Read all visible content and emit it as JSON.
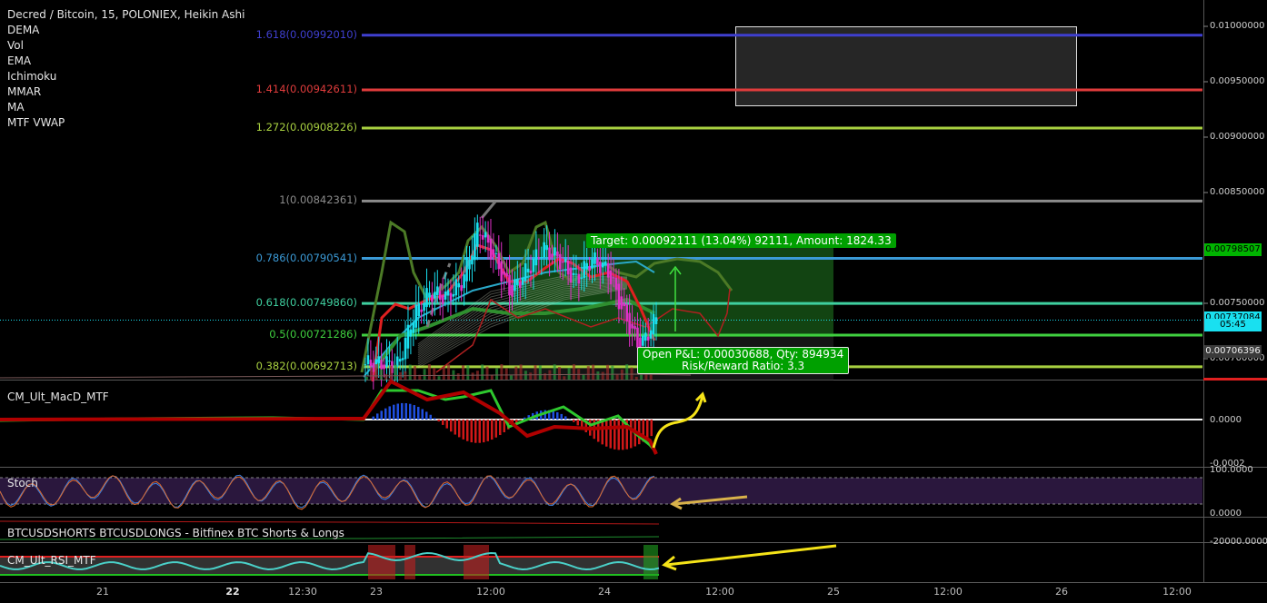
{
  "chart_title": "Decred / Bitcoin, 15, POLONIEX, Heikin Ashi",
  "indicators": [
    "DEMA",
    "Vol",
    "EMA",
    "Ichimoku",
    "MMAR",
    "MA",
    "MTF VWAP"
  ],
  "panes": {
    "macd": "CM_Ult_MacD_MTF",
    "stoch": "Stoch",
    "shorts_longs": "BTCUSDSHORTS BTCUSDLONGS - Bitfinex BTC Shorts & Longs",
    "rsi": "CM_Ult_RSI_MTF"
  },
  "fib_levels": [
    {
      "label": "1.618(0.00992010)",
      "value": 0.0099201,
      "color": "#3f3fcf"
    },
    {
      "label": "1.414(0.00942611)",
      "value": 0.00942611,
      "color": "#e03c3c"
    },
    {
      "label": "1.272(0.00908226)",
      "value": 0.00908226,
      "color": "#a8d040"
    },
    {
      "label": "1(0.00842361)",
      "value": 0.00842361,
      "color": "#8c8c8c"
    },
    {
      "label": "0.786(0.00790541)",
      "value": 0.00790541,
      "color": "#3b9ad6"
    },
    {
      "label": "0.618(0.00749860)",
      "value": 0.0074986,
      "color": "#3fcf9f"
    },
    {
      "label": "0.5(0.00721286)",
      "value": 0.00721286,
      "color": "#3fcf3f"
    },
    {
      "label": "0.382(0.00692713)",
      "value": 0.00692713,
      "color": "#a8d040"
    }
  ],
  "price_axis": {
    "ticks": [
      "0.01000000",
      "0.00950000",
      "0.00900000",
      "0.00850000",
      "0.00750000",
      "0.00700000"
    ],
    "tick_values": [
      0.01,
      0.0095,
      0.009,
      0.0085,
      0.0075,
      0.007
    ],
    "tags": [
      {
        "text": "0.00798507",
        "value": 0.00798507,
        "bg": "#00b400"
      },
      {
        "text": "0.00737084",
        "value": 0.00737084,
        "bg": "#19e0f0"
      },
      {
        "text": "05:45",
        "value": 0.0073,
        "bg": "#19e0f0"
      },
      {
        "text": "0.00706396",
        "value": 0.00706396,
        "bg": "#3a3a3a"
      }
    ]
  },
  "macd_axis": [
    "0.0000",
    "-0.0002"
  ],
  "stoch_axis": [
    "100.0000",
    "0.0000"
  ],
  "shorts_axis": [
    "-20000.0000"
  ],
  "time_axis": [
    "21",
    "22",
    "12:30",
    "23",
    "12:00",
    "24",
    "12:00",
    "25",
    "12:00",
    "26",
    "12:00"
  ],
  "trade": {
    "target": "Target: 0.00092111 (13.04%) 92111, Amount: 1824.33",
    "open_pnl": "Open P&L: 0.00030688, Qty: 894934",
    "risk_reward": "Risk/Reward Ratio: 3.3"
  },
  "chart_data": {
    "type": "candlestick",
    "title": "Decred / Bitcoin, 15, POLONIEX, Heikin Ashi",
    "x_ticks": [
      "21",
      "22",
      "12:30",
      "23",
      "12:00",
      "24",
      "12:00",
      "25",
      "12:00",
      "26",
      "12:00"
    ],
    "price_range": [
      0.00685,
      0.0102
    ],
    "approx_close_path": [
      0.00695,
      0.00696,
      0.00694,
      0.0074,
      0.0076,
      0.00755,
      0.0077,
      0.0082,
      0.0079,
      0.0076,
      0.0078,
      0.008,
      0.0079,
      0.0077,
      0.0079,
      0.0078,
      0.0074,
      0.0071,
      0.00737
    ],
    "last_price": 0.00737084,
    "colors": {
      "bull": "#19e0f0",
      "bear": "#e030c8",
      "accent_green": "#00b400"
    }
  }
}
